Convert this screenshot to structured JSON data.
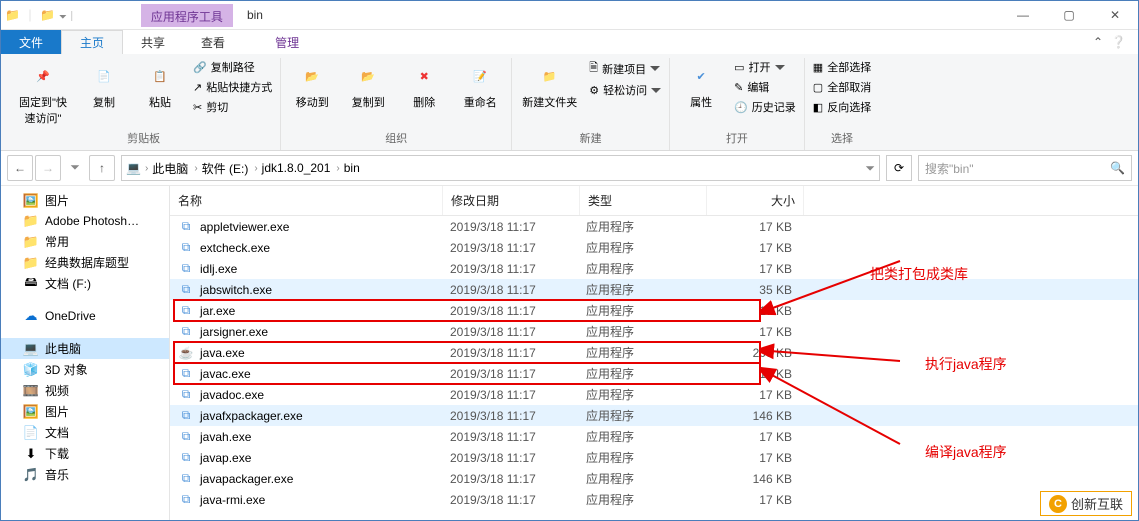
{
  "title_context": "应用程序工具",
  "title": "bin",
  "tabs": {
    "file": "文件",
    "home": "主页",
    "share": "共享",
    "view": "查看",
    "manage": "管理"
  },
  "ribbon": {
    "pin": "固定到\"快速访问\"",
    "copy": "复制",
    "paste": "粘贴",
    "copy_path": "复制路径",
    "paste_shortcut": "粘贴快捷方式",
    "cut": "剪切",
    "group_clipboard": "剪贴板",
    "move_to": "移动到",
    "copy_to": "复制到",
    "delete": "删除",
    "rename": "重命名",
    "group_org": "组织",
    "new_folder": "新建文件夹",
    "new_item": "新建项目",
    "easy_access": "轻松访问",
    "group_new": "新建",
    "properties": "属性",
    "open": "打开",
    "edit": "编辑",
    "history": "历史记录",
    "group_open": "打开",
    "select_all": "全部选择",
    "select_none": "全部取消",
    "invert": "反向选择",
    "group_select": "选择"
  },
  "breadcrumb": [
    "此电脑",
    "软件 (E:)",
    "jdk1.8.0_201",
    "bin"
  ],
  "search_placeholder": "搜索\"bin\"",
  "columns": {
    "name": "名称",
    "date": "修改日期",
    "type": "类型",
    "size": "大小"
  },
  "nav": [
    {
      "icon": "🖼️",
      "label": "图片"
    },
    {
      "icon": "📁",
      "label": "Adobe Photosh…"
    },
    {
      "icon": "📁",
      "label": "常用"
    },
    {
      "icon": "📁",
      "label": "经典数据库题型"
    },
    {
      "icon": "🖴",
      "label": "文档 (F:)"
    },
    {
      "spacer": true
    },
    {
      "icon": "☁",
      "label": "OneDrive",
      "cls": "ico-cloud"
    },
    {
      "spacer": true
    },
    {
      "icon": "💻",
      "label": "此电脑",
      "cls": "ico-pc",
      "selected": true
    },
    {
      "icon": "🧊",
      "label": "3D 对象"
    },
    {
      "icon": "🎞️",
      "label": "视频"
    },
    {
      "icon": "🖼️",
      "label": "图片"
    },
    {
      "icon": "📄",
      "label": "文档"
    },
    {
      "icon": "⬇",
      "label": "下载"
    },
    {
      "icon": "🎵",
      "label": "音乐"
    }
  ],
  "files": [
    {
      "icon": "⧉",
      "name": "appletviewer.exe",
      "date": "2019/3/18 11:17",
      "type": "应用程序",
      "size": "17 KB"
    },
    {
      "icon": "⧉",
      "name": "extcheck.exe",
      "date": "2019/3/18 11:17",
      "type": "应用程序",
      "size": "17 KB"
    },
    {
      "icon": "⧉",
      "name": "idlj.exe",
      "date": "2019/3/18 11:17",
      "type": "应用程序",
      "size": "17 KB"
    },
    {
      "icon": "⧉",
      "name": "jabswitch.exe",
      "date": "2019/3/18 11:17",
      "type": "应用程序",
      "size": "35 KB",
      "hl": 2
    },
    {
      "icon": "⧉",
      "name": "jar.exe",
      "date": "2019/3/18 11:17",
      "type": "应用程序",
      "size": "17 KB",
      "box": true
    },
    {
      "icon": "⧉",
      "name": "jarsigner.exe",
      "date": "2019/3/18 11:17",
      "type": "应用程序",
      "size": "17 KB"
    },
    {
      "icon": "☕",
      "name": "java.exe",
      "date": "2019/3/18 11:17",
      "type": "应用程序",
      "size": "203 KB",
      "box": true
    },
    {
      "icon": "⧉",
      "name": "javac.exe",
      "date": "2019/3/18 11:17",
      "type": "应用程序",
      "size": "17 KB",
      "box": true
    },
    {
      "icon": "⧉",
      "name": "javadoc.exe",
      "date": "2019/3/18 11:17",
      "type": "应用程序",
      "size": "17 KB"
    },
    {
      "icon": "⧉",
      "name": "javafxpackager.exe",
      "date": "2019/3/18 11:17",
      "type": "应用程序",
      "size": "146 KB",
      "hl": 2
    },
    {
      "icon": "⧉",
      "name": "javah.exe",
      "date": "2019/3/18 11:17",
      "type": "应用程序",
      "size": "17 KB"
    },
    {
      "icon": "⧉",
      "name": "javap.exe",
      "date": "2019/3/18 11:17",
      "type": "应用程序",
      "size": "17 KB"
    },
    {
      "icon": "⧉",
      "name": "javapackager.exe",
      "date": "2019/3/18 11:17",
      "type": "应用程序",
      "size": "146 KB"
    },
    {
      "icon": "⧉",
      "name": "java-rmi.exe",
      "date": "2019/3/18 11:17",
      "type": "应用程序",
      "size": "17 KB"
    }
  ],
  "annotations": {
    "a1": "把类打包成类库",
    "a2": "执行java程序",
    "a3": "编译java程序"
  },
  "watermark": "创新互联"
}
